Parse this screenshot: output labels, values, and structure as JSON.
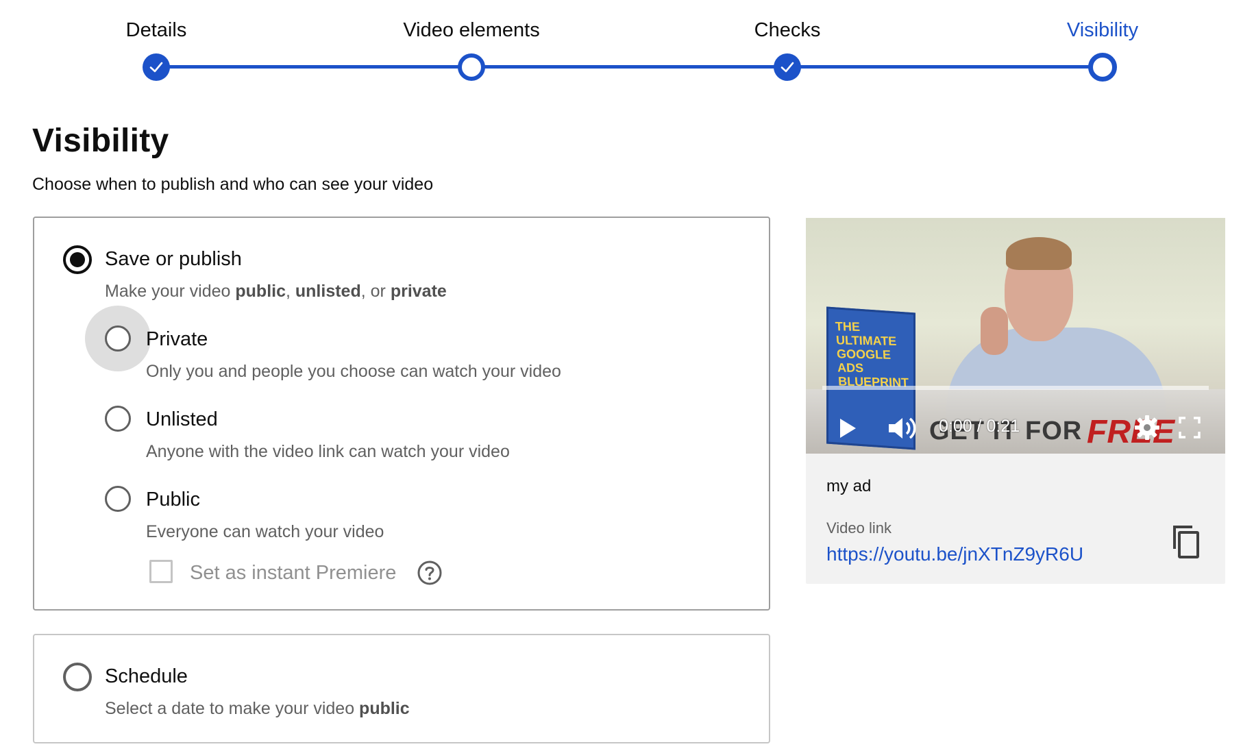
{
  "stepper": {
    "steps": [
      {
        "label": "Details",
        "state": "done"
      },
      {
        "label": "Video elements",
        "state": "pending"
      },
      {
        "label": "Checks",
        "state": "done"
      },
      {
        "label": "Visibility",
        "state": "current"
      }
    ],
    "accent_color": "#1c52c9"
  },
  "page": {
    "title": "Visibility",
    "subtitle": "Choose when to publish and who can see your video"
  },
  "save_publish": {
    "title": "Save or publish",
    "desc_prefix": "Make your video ",
    "desc_public": "public",
    "desc_comma": ", ",
    "desc_unlisted": "unlisted",
    "desc_or": ", or ",
    "desc_private": "private",
    "selected": true,
    "options": [
      {
        "label": "Private",
        "desc": "Only you and people you choose can watch your video",
        "selected": false
      },
      {
        "label": "Unlisted",
        "desc": "Anyone with the video link can watch your video",
        "selected": false
      },
      {
        "label": "Public",
        "desc": "Everyone can watch your video",
        "selected": false
      }
    ],
    "premiere": {
      "label": "Set as instant Premiere",
      "checked": false,
      "icon": "help-icon"
    }
  },
  "schedule": {
    "title": "Schedule",
    "desc_prefix": "Select a date to make your video ",
    "desc_public": "public",
    "selected": false
  },
  "preview": {
    "book_title": "THE ULTIMATE GOOGLE ADS BLUEPRINT",
    "banner_text": "GET IT FOR",
    "banner_free": "FREE",
    "time": "0:00 / 0:21",
    "progress": 0,
    "video_name": "my ad",
    "link_label": "Video link",
    "link_url": "https://youtu.be/jnXTnZ9yR6U",
    "icons": [
      "play-icon",
      "volume-icon",
      "settings-icon",
      "fullscreen-icon",
      "copy-icon"
    ]
  }
}
